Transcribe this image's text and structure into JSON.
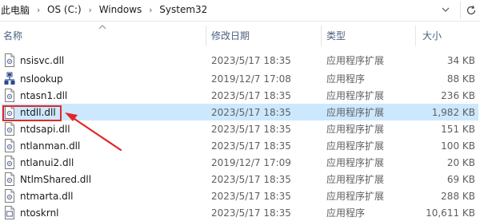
{
  "breadcrumb": {
    "items": [
      "此电脑",
      "OS (C:)",
      "Windows",
      "System32"
    ],
    "separator": "›"
  },
  "columns": {
    "name": "名称",
    "date": "修改日期",
    "type": "类型",
    "size": "大小"
  },
  "files": [
    {
      "name": "nsisvc.dll",
      "date": "2023/5/17 18:35",
      "type": "应用程序扩展",
      "size": "34 KB",
      "icon": "dll-file-icon"
    },
    {
      "name": "nslookup",
      "date": "2019/12/7 17:08",
      "type": "应用程序",
      "size": "88 KB",
      "icon": "network-app-icon"
    },
    {
      "name": "ntasn1.dll",
      "date": "2023/5/17 18:35",
      "type": "应用程序扩展",
      "size": "236 KB",
      "icon": "dll-file-icon"
    },
    {
      "name": "ntdll.dll",
      "date": "2023/5/17 18:35",
      "type": "应用程序扩展",
      "size": "1,982 KB",
      "icon": "dll-file-icon"
    },
    {
      "name": "ntdsapi.dll",
      "date": "2023/5/17 18:35",
      "type": "应用程序扩展",
      "size": "151 KB",
      "icon": "dll-file-icon"
    },
    {
      "name": "ntlanman.dll",
      "date": "2023/5/17 18:35",
      "type": "应用程序扩展",
      "size": "100 KB",
      "icon": "dll-file-icon"
    },
    {
      "name": "ntlanui2.dll",
      "date": "2019/12/7 17:09",
      "type": "应用程序扩展",
      "size": "20 KB",
      "icon": "dll-file-icon"
    },
    {
      "name": "NtlmShared.dll",
      "date": "2023/5/17 18:35",
      "type": "应用程序扩展",
      "size": "69 KB",
      "icon": "dll-file-icon"
    },
    {
      "name": "ntmarta.dll",
      "date": "2023/5/17 18:35",
      "type": "应用程序扩展",
      "size": "288 KB",
      "icon": "dll-file-icon"
    },
    {
      "name": "ntoskrnl",
      "date": "2023/5/17 18:35",
      "type": "应用程序",
      "size": "10,611 KB",
      "icon": "exe-file-icon"
    }
  ],
  "selected_file": "ntdll.dll",
  "colors": {
    "selection": "#cce8ff",
    "annotation": "#e02828",
    "header_text": "#4d6082"
  }
}
